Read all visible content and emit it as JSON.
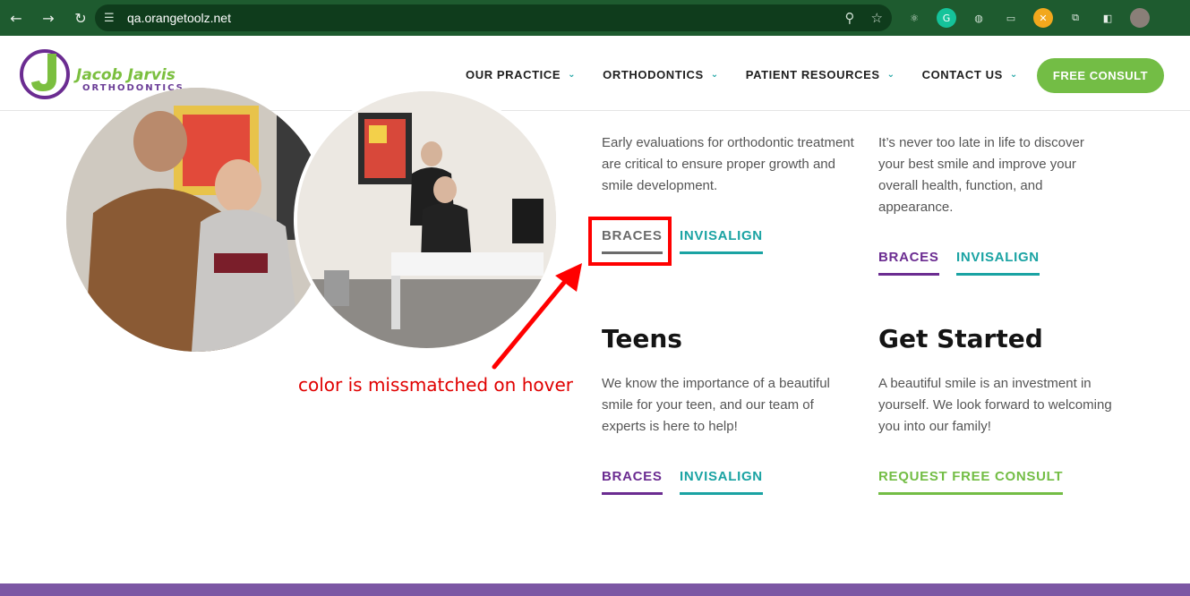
{
  "browser": {
    "url": "qa.orangetoolz.net"
  },
  "header": {
    "logo_name": "Jacob Jarvis",
    "logo_sub": "ORTHODONTICS",
    "nav": [
      {
        "label": "OUR PRACTICE"
      },
      {
        "label": "ORTHODONTICS"
      },
      {
        "label": "PATIENT RESOURCES"
      },
      {
        "label": "CONTACT US"
      }
    ],
    "cta": "FREE CONSULT"
  },
  "sections": {
    "children": {
      "desc": "Early evaluations for orthodontic treatment are critical to ensure proper growth and smile development.",
      "braces": "BRACES",
      "invisalign": "INVISALIGN"
    },
    "adults": {
      "desc": "It’s never too late in life to discover your best smile and improve your overall health, function, and appearance.",
      "braces": "BRACES",
      "invisalign": "INVISALIGN"
    },
    "teens": {
      "title": "Teens",
      "desc": "We know the importance of a beautiful smile for your teen, and our team of experts is here to help!",
      "braces": "BRACES",
      "invisalign": "INVISALIGN"
    },
    "started": {
      "title": "Get Started",
      "desc": "A beautiful smile is an investment in yourself. We look forward to welcoming you into our family!",
      "link": "REQUEST FREE CONSULT"
    }
  },
  "annotation": {
    "text": "color is missmatched on hover"
  },
  "colors": {
    "browser_bar": "#1e5b2f",
    "purple": "#6b2c91",
    "teal": "#1aa3a3",
    "green": "#73bd45",
    "hover_gray": "#6b6b6b",
    "annotation_red": "#ff0000"
  }
}
